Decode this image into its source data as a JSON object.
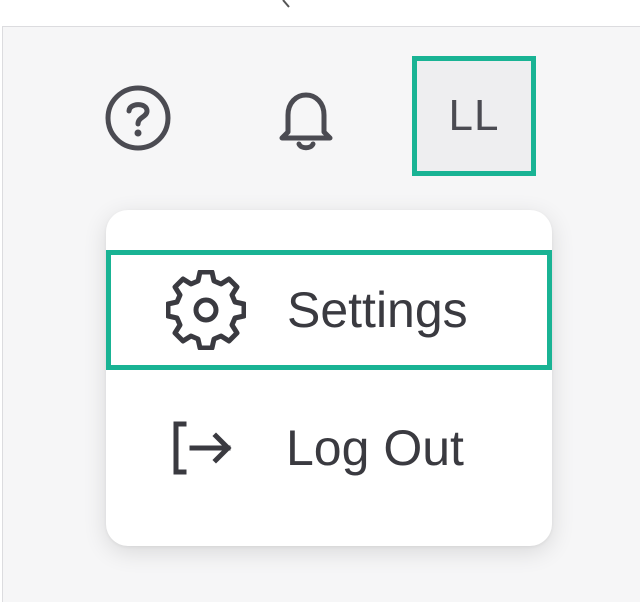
{
  "header": {
    "help_icon": "help-circle-icon",
    "notifications_icon": "bell-icon",
    "avatar_initials": "LL"
  },
  "user_menu": {
    "items": [
      {
        "label": "Settings",
        "icon": "gear-icon"
      },
      {
        "label": "Log Out",
        "icon": "log-out-icon"
      }
    ]
  },
  "colors": {
    "focus_outline": "#19b394",
    "icon": "#4b4b52",
    "text": "#3a3a40",
    "background": "#f6f6f7",
    "menu_background": "#ffffff"
  }
}
